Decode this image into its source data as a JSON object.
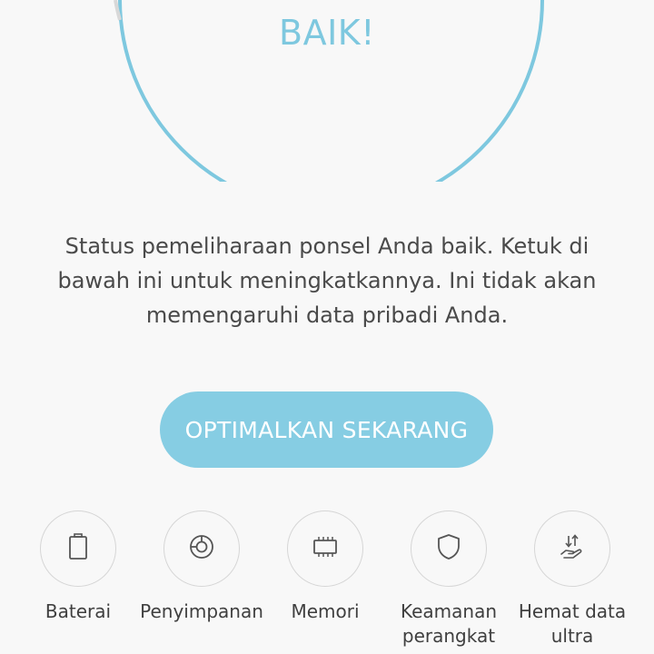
{
  "status": {
    "word": "BAIK!",
    "description": "Status pemeliharaan ponsel Anda baik. Ketuk di bawah ini untuk meningkatkannya. Ini tidak akan memengaruhi data pribadi Anda."
  },
  "action": {
    "optimize_label": "OPTIMALKAN SEKARANG"
  },
  "features": [
    {
      "label": "Baterai",
      "icon": "battery-icon"
    },
    {
      "label": "Penyimpanan",
      "icon": "storage-icon"
    },
    {
      "label": "Memori",
      "icon": "memory-chip-icon"
    },
    {
      "label": "Keamanan perangkat",
      "icon": "shield-icon"
    },
    {
      "label": "Hemat data ultra",
      "icon": "data-saver-icon"
    }
  ],
  "colors": {
    "accent": "#86cde3",
    "gauge_ring": "#7ec8df",
    "text": "#4a4a4a",
    "background": "#f8f8f8"
  }
}
